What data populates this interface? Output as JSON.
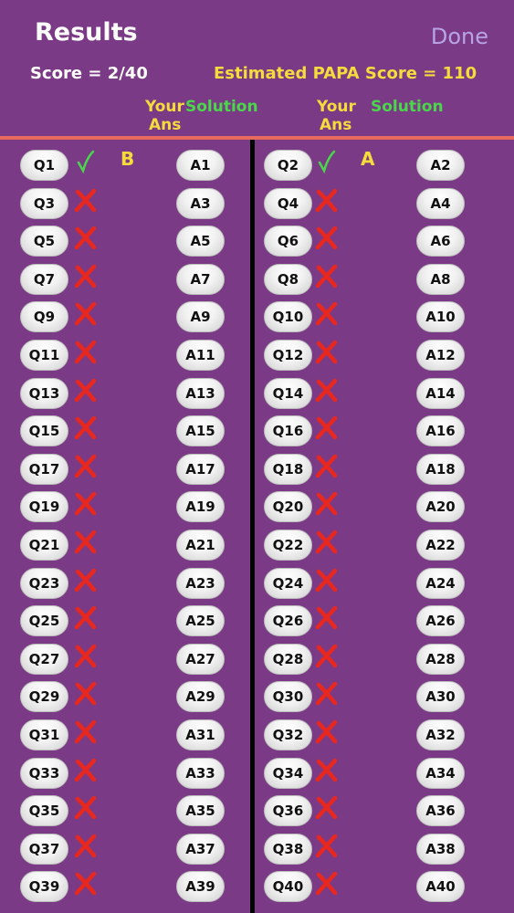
{
  "header": {
    "title": "Results",
    "done_label": "Done",
    "score_text": "Score = 2/40",
    "papa_text": "Estimated PAPA Score = 110"
  },
  "columns": {
    "left": {
      "your": "Your",
      "ans": "Ans",
      "solution": "Solution"
    },
    "right": {
      "your": "Your",
      "ans": "Ans",
      "solution": "Solution"
    }
  },
  "colors": {
    "background": "#7b3a85",
    "accent_yellow": "#f5dc3c",
    "accent_green": "#49d84a",
    "correct": "#49d84a",
    "wrong": "#e8281e",
    "done": "#b8a3e6"
  },
  "rows": [
    {
      "left": {
        "q": "Q1",
        "a": "A1",
        "result": "correct",
        "your_answer": "B"
      },
      "right": {
        "q": "Q2",
        "a": "A2",
        "result": "correct",
        "your_answer": "A"
      }
    },
    {
      "left": {
        "q": "Q3",
        "a": "A3",
        "result": "wrong",
        "your_answer": ""
      },
      "right": {
        "q": "Q4",
        "a": "A4",
        "result": "wrong",
        "your_answer": ""
      }
    },
    {
      "left": {
        "q": "Q5",
        "a": "A5",
        "result": "wrong",
        "your_answer": ""
      },
      "right": {
        "q": "Q6",
        "a": "A6",
        "result": "wrong",
        "your_answer": ""
      }
    },
    {
      "left": {
        "q": "Q7",
        "a": "A7",
        "result": "wrong",
        "your_answer": ""
      },
      "right": {
        "q": "Q8",
        "a": "A8",
        "result": "wrong",
        "your_answer": ""
      }
    },
    {
      "left": {
        "q": "Q9",
        "a": "A9",
        "result": "wrong",
        "your_answer": ""
      },
      "right": {
        "q": "Q10",
        "a": "A10",
        "result": "wrong",
        "your_answer": ""
      }
    },
    {
      "left": {
        "q": "Q11",
        "a": "A11",
        "result": "wrong",
        "your_answer": ""
      },
      "right": {
        "q": "Q12",
        "a": "A12",
        "result": "wrong",
        "your_answer": ""
      }
    },
    {
      "left": {
        "q": "Q13",
        "a": "A13",
        "result": "wrong",
        "your_answer": ""
      },
      "right": {
        "q": "Q14",
        "a": "A14",
        "result": "wrong",
        "your_answer": ""
      }
    },
    {
      "left": {
        "q": "Q15",
        "a": "A15",
        "result": "wrong",
        "your_answer": ""
      },
      "right": {
        "q": "Q16",
        "a": "A16",
        "result": "wrong",
        "your_answer": ""
      }
    },
    {
      "left": {
        "q": "Q17",
        "a": "A17",
        "result": "wrong",
        "your_answer": ""
      },
      "right": {
        "q": "Q18",
        "a": "A18",
        "result": "wrong",
        "your_answer": ""
      }
    },
    {
      "left": {
        "q": "Q19",
        "a": "A19",
        "result": "wrong",
        "your_answer": ""
      },
      "right": {
        "q": "Q20",
        "a": "A20",
        "result": "wrong",
        "your_answer": ""
      }
    },
    {
      "left": {
        "q": "Q21",
        "a": "A21",
        "result": "wrong",
        "your_answer": ""
      },
      "right": {
        "q": "Q22",
        "a": "A22",
        "result": "wrong",
        "your_answer": ""
      }
    },
    {
      "left": {
        "q": "Q23",
        "a": "A23",
        "result": "wrong",
        "your_answer": ""
      },
      "right": {
        "q": "Q24",
        "a": "A24",
        "result": "wrong",
        "your_answer": ""
      }
    },
    {
      "left": {
        "q": "Q25",
        "a": "A25",
        "result": "wrong",
        "your_answer": ""
      },
      "right": {
        "q": "Q26",
        "a": "A26",
        "result": "wrong",
        "your_answer": ""
      }
    },
    {
      "left": {
        "q": "Q27",
        "a": "A27",
        "result": "wrong",
        "your_answer": ""
      },
      "right": {
        "q": "Q28",
        "a": "A28",
        "result": "wrong",
        "your_answer": ""
      }
    },
    {
      "left": {
        "q": "Q29",
        "a": "A29",
        "result": "wrong",
        "your_answer": ""
      },
      "right": {
        "q": "Q30",
        "a": "A30",
        "result": "wrong",
        "your_answer": ""
      }
    },
    {
      "left": {
        "q": "Q31",
        "a": "A31",
        "result": "wrong",
        "your_answer": ""
      },
      "right": {
        "q": "Q32",
        "a": "A32",
        "result": "wrong",
        "your_answer": ""
      }
    },
    {
      "left": {
        "q": "Q33",
        "a": "A33",
        "result": "wrong",
        "your_answer": ""
      },
      "right": {
        "q": "Q34",
        "a": "A34",
        "result": "wrong",
        "your_answer": ""
      }
    },
    {
      "left": {
        "q": "Q35",
        "a": "A35",
        "result": "wrong",
        "your_answer": ""
      },
      "right": {
        "q": "Q36",
        "a": "A36",
        "result": "wrong",
        "your_answer": ""
      }
    },
    {
      "left": {
        "q": "Q37",
        "a": "A37",
        "result": "wrong",
        "your_answer": ""
      },
      "right": {
        "q": "Q38",
        "a": "A38",
        "result": "wrong",
        "your_answer": ""
      }
    },
    {
      "left": {
        "q": "Q39",
        "a": "A39",
        "result": "wrong",
        "your_answer": ""
      },
      "right": {
        "q": "Q40",
        "a": "A40",
        "result": "wrong",
        "your_answer": ""
      }
    }
  ]
}
